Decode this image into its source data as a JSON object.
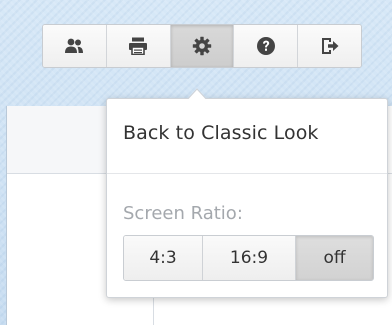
{
  "toolbar": {
    "buttons": [
      {
        "icon": "users-icon",
        "active": false
      },
      {
        "icon": "print-icon",
        "active": false
      },
      {
        "icon": "gear-icon",
        "active": true
      },
      {
        "icon": "help-icon",
        "active": false
      },
      {
        "icon": "logout-icon",
        "active": false
      }
    ]
  },
  "popup": {
    "classic_label": "Back to Classic Look",
    "screen_ratio_label": "Screen Ratio:",
    "ratio_options": [
      "4:3",
      "16:9",
      "off"
    ],
    "selected_ratio": "off"
  },
  "colors": {
    "background": "#cfe1f3",
    "icon": "#444444",
    "text": "#333333",
    "muted_text": "#a4a8ad"
  }
}
